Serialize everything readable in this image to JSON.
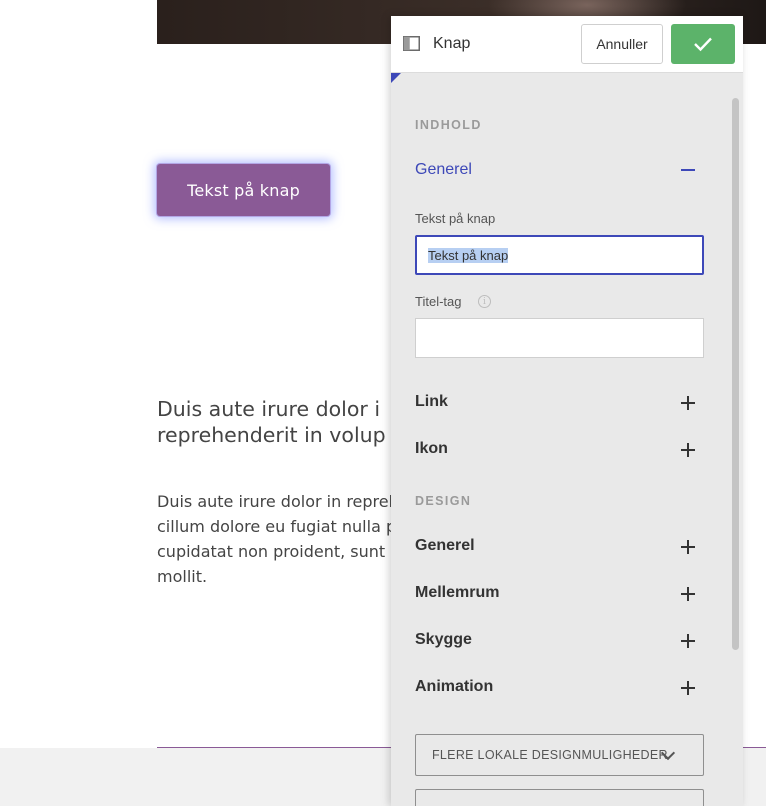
{
  "page": {
    "button_label": "Tekst på knap",
    "heading": "Duis aute irure dolor i\nreprehenderit in volup",
    "body": "Duis aute irure dolor in repreh\ncillum dolore eu fugiat nulla p\ncupidatat non proident, sunt i\nmollit."
  },
  "panel": {
    "title": "Knap",
    "cancel_label": "Annuller",
    "confirm_icon": "check-icon",
    "sections": {
      "content_label": "INDHOLD",
      "design_label": "DESIGN"
    },
    "content_rows": {
      "general": "Generel",
      "link": "Link",
      "icon": "Ikon"
    },
    "fields": {
      "button_text_label": "Tekst på knap",
      "button_text_value": "Tekst på knap",
      "title_tag_label": "Titel-tag",
      "title_tag_value": "",
      "info_icon": "i"
    },
    "design_rows": {
      "general": "Generel",
      "spacing": "Mellemrum",
      "shadow": "Skygge",
      "animation": "Animation"
    },
    "more_options": "FLERE LOKALE DESIGNMULIGHEDER"
  },
  "colors": {
    "accent": "#3d48b8",
    "confirm": "#5cb36a",
    "page_button": "#8a5a96"
  }
}
